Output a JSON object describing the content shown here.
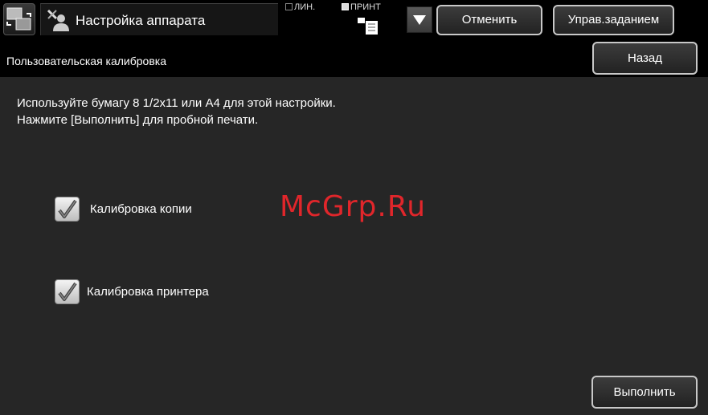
{
  "header": {
    "title": "Настройка аппарата",
    "status_line_label": "ЛИН.",
    "status_print_label": "ПРИНТ",
    "cancel_label": "Отменить",
    "job_status_label": "Управ.заданием",
    "icons": {
      "mode_switch": "mode-switch-icon",
      "settings": "settings-person-icon",
      "print_job": "print-job-icon",
      "dropdown": "chevron-down-icon"
    }
  },
  "subheader": {
    "title": "Пользовательская калибровка",
    "back_label": "Назад"
  },
  "content": {
    "instruction_line1": "Используйте бумагу 8 1/2x11 или A4 для этой настройки.",
    "instruction_line2": "Нажмите [Выполнить] для пробной печати.",
    "options": [
      {
        "label": "Калибровка копии",
        "checked": true
      },
      {
        "label": "Калибровка принтера",
        "checked": true
      }
    ],
    "execute_label": "Выполнить"
  },
  "watermark": "McGrp.Ru",
  "colors": {
    "background": "#262626",
    "bar": "#000000",
    "watermark": "#e0262b"
  }
}
